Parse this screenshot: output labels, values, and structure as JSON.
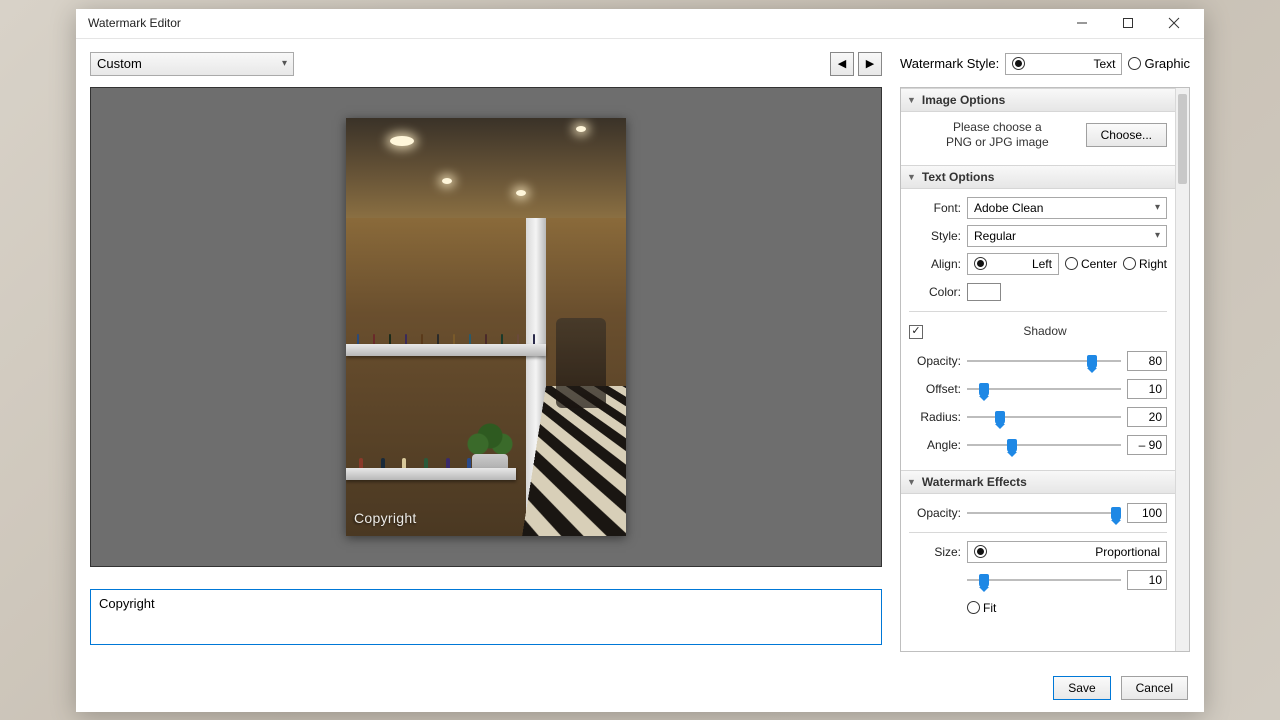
{
  "window": {
    "title": "Watermark Editor"
  },
  "preset": {
    "value": "Custom"
  },
  "preview": {
    "watermark_text": "Copyright"
  },
  "text_input": {
    "value": "Copyright"
  },
  "style": {
    "label": "Watermark Style:",
    "options": {
      "text": "Text",
      "graphic": "Graphic"
    },
    "selected": "text"
  },
  "sections": {
    "image": {
      "title": "Image Options",
      "note_l1": "Please choose a",
      "note_l2": "PNG or JPG image",
      "choose": "Choose..."
    },
    "text": {
      "title": "Text Options",
      "font_label": "Font:",
      "font_value": "Adobe Clean",
      "style_label": "Style:",
      "style_value": "Regular",
      "align_label": "Align:",
      "align": {
        "left": "Left",
        "center": "Center",
        "right": "Right",
        "selected": "left"
      },
      "color_label": "Color:",
      "shadow_checked": true,
      "shadow_label": "Shadow",
      "opacity_label": "Opacity:",
      "opacity_value": "80",
      "offset_label": "Offset:",
      "offset_value": "10",
      "radius_label": "Radius:",
      "radius_value": "20",
      "angle_label": "Angle:",
      "angle_value": "– 90"
    },
    "effects": {
      "title": "Watermark Effects",
      "opacity_label": "Opacity:",
      "opacity_value": "100",
      "size_label": "Size:",
      "proportional": "Proportional",
      "size_value": "10",
      "fit": "Fit",
      "size_selected": "proportional"
    }
  },
  "footer": {
    "save": "Save",
    "cancel": "Cancel"
  }
}
